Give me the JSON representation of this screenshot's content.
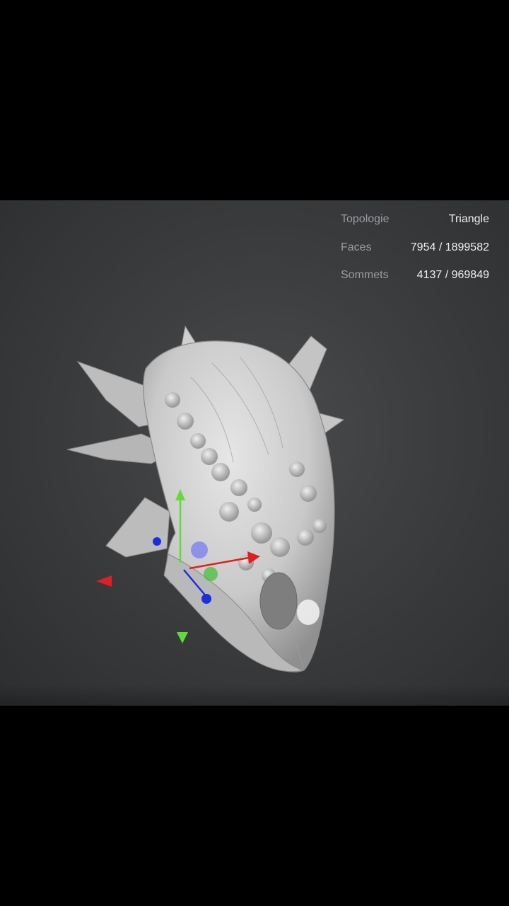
{
  "stats": {
    "topology_label": "Topologie",
    "topology_value": "Triangle",
    "faces_label": "Faces",
    "faces_value": "7954 / 1899582",
    "vertices_label": "Sommets",
    "vertices_value": "4137 / 969849"
  },
  "gizmo": {
    "x_axis_color": "#e02020",
    "y_axis_color": "#5fdc3c",
    "z_axis_color": "#1a2ee0"
  },
  "model": {
    "name_icon": "dragon-skull-mesh",
    "surface_color": "#d4d4d4"
  }
}
